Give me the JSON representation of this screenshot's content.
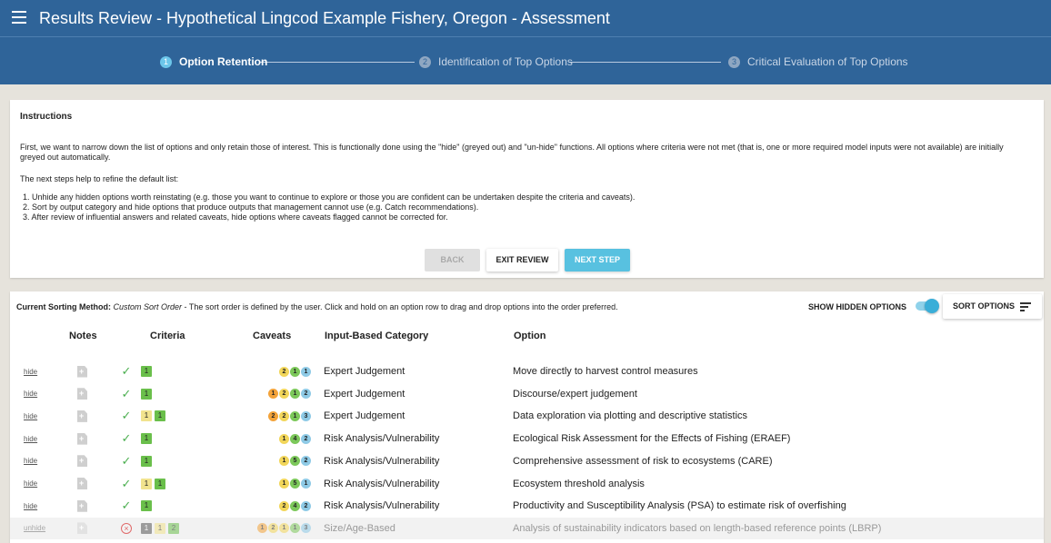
{
  "header": {
    "title": "Results Review - Hypothetical Lingcod Example Fishery, Oregon - Assessment",
    "menu_icon": "hamburger-menu-icon"
  },
  "steps": [
    {
      "num": "1",
      "label": "Option Retention",
      "active": true
    },
    {
      "num": "2",
      "label": "Identification of Top Options",
      "active": false
    },
    {
      "num": "3",
      "label": "Critical Evaluation of Top Options",
      "active": false
    }
  ],
  "instructions": {
    "title": "Instructions",
    "paragraph": "First, we want to narrow down the list of options and only retain those of interest. This is functionally done using the \"hide\" (greyed out) and \"un-hide\" functions. All options where criteria were not met (that is, one or more required model inputs were not available) are initially greyed out automatically.",
    "next_steps": "The next steps help to refine the default list:",
    "list": [
      "1. Unhide any hidden options worth reinstating (e.g. those you want to continue to explore or those you are confident can be undertaken despite the criteria and caveats).",
      "2. Sort by output category and hide options that produce outputs that management cannot use (e.g. Catch recommendations).",
      "3. After review of influential answers and related caveats, hide options where caveats flagged cannot be corrected for."
    ],
    "back_label": "BACK",
    "exit_label": "EXIT REVIEW",
    "next_label": "NEXT STEP"
  },
  "table": {
    "sort_prefix": "Current Sorting Method:",
    "sort_mode": "Custom Sort Order",
    "sort_desc": " - The sort order is defined by the user. Click and hold on an option row to drag and drop options into the order preferred.",
    "show_hidden_label": "SHOW HIDDEN OPTIONS",
    "show_hidden_on": true,
    "sort_button_label": "SORT OPTIONS",
    "columns": {
      "notes": "Notes",
      "criteria": "Criteria",
      "caveats": "Caveats",
      "category": "Input-Based Category",
      "option": "Option"
    },
    "rows": [
      {
        "action": "hide",
        "criteria_met": true,
        "criteria": [
          "1"
        ],
        "caveats": [
          "2",
          "1",
          "1"
        ],
        "category": "Expert Judgement",
        "option": "Move directly to harvest control measures"
      },
      {
        "action": "hide",
        "criteria_met": true,
        "criteria": [
          "1"
        ],
        "caveats": [
          "1",
          "2",
          "1",
          "2"
        ],
        "category": "Expert Judgement",
        "option": "Discourse/expert judgement"
      },
      {
        "action": "hide",
        "criteria_met": true,
        "criteria": [
          "1",
          "1"
        ],
        "caveats": [
          "2",
          "2",
          "1",
          "3"
        ],
        "category": "Expert Judgement",
        "option": "Data exploration via plotting and descriptive statistics"
      },
      {
        "action": "hide",
        "criteria_met": true,
        "criteria": [
          "1"
        ],
        "caveats": [
          "1",
          "4",
          "2"
        ],
        "category": "Risk Analysis/Vulnerability",
        "option": "Ecological Risk Assessment for the Effects of Fishing (ERAEF)"
      },
      {
        "action": "hide",
        "criteria_met": true,
        "criteria": [
          "1"
        ],
        "caveats": [
          "1",
          "5",
          "2"
        ],
        "category": "Risk Analysis/Vulnerability",
        "option": "Comprehensive assessment of risk to ecosystems (CARE)"
      },
      {
        "action": "hide",
        "criteria_met": true,
        "criteria": [
          "1",
          "1"
        ],
        "caveats": [
          "1",
          "5",
          "1"
        ],
        "category": "Risk Analysis/Vulnerability",
        "option": "Ecosystem threshold analysis"
      },
      {
        "action": "hide",
        "criteria_met": true,
        "criteria": [
          "1"
        ],
        "caveats": [
          "2",
          "4",
          "2"
        ],
        "category": "Risk Analysis/Vulnerability",
        "option": "Productivity and Susceptibility Analysis (PSA) to estimate risk of overfishing"
      },
      {
        "action": "unhide",
        "criteria_met": false,
        "criteria": [
          "1",
          "1",
          "2"
        ],
        "caveats": [
          "1",
          "2",
          "1",
          "1",
          "3"
        ],
        "category": "Size/Age-Based",
        "option": "Analysis of sustainability indicators based on length-based reference points (LBRP)"
      }
    ]
  },
  "colors": {
    "header_bg": "#2f6499",
    "accent": "#58c1e0",
    "criteria_green": "#6abf4b",
    "criteria_yellow": "#f1e38e",
    "criteria_dark": "#555555",
    "caveat_orange": "#f3a33a",
    "caveat_yellow": "#f2d65a",
    "caveat_green": "#7cc85a",
    "caveat_blue": "#8ecae6"
  }
}
